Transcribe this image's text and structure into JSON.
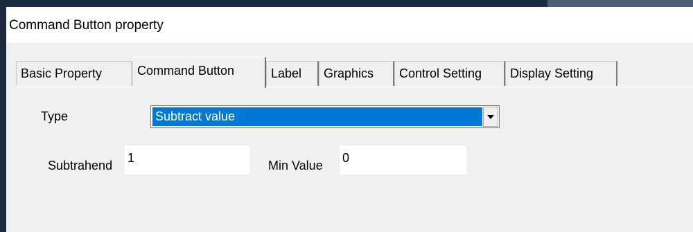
{
  "window": {
    "title": "Command Button property"
  },
  "tabs": [
    {
      "label": "Basic Property",
      "active": false
    },
    {
      "label": "Command Button",
      "active": true
    },
    {
      "label": "Label",
      "active": false
    },
    {
      "label": "Graphics",
      "active": false
    },
    {
      "label": "Control Setting",
      "active": false
    },
    {
      "label": "Display Setting",
      "active": false
    }
  ],
  "form": {
    "type_label": "Type",
    "type_value": "Subtract value",
    "subtrahend_label": "Subtrahend",
    "subtrahend_value": "1",
    "min_value_label": "Min Value",
    "min_value_value": "0"
  },
  "colors": {
    "selection": "#0078d7",
    "dialog_bg": "#f0f0f0",
    "field_bg": "#ffffff"
  },
  "icons": {
    "dropdown": "chevron-down-icon"
  }
}
